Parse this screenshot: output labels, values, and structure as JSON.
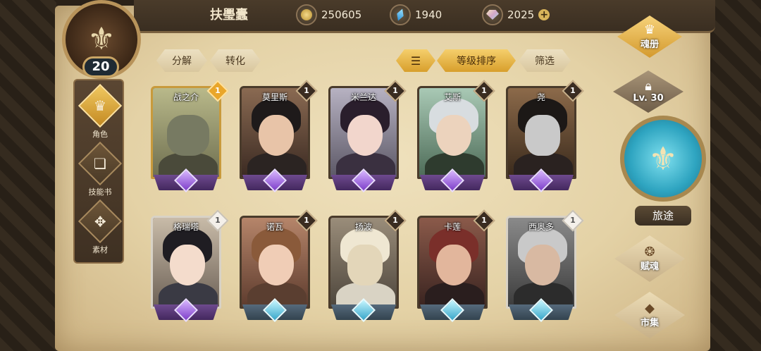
{
  "header": {
    "title": "扶璺蠹",
    "level": "20",
    "currencies": [
      {
        "icon": "gold-coin-icon",
        "value": "250605"
      },
      {
        "icon": "blue-crystal-icon",
        "value": "1940"
      },
      {
        "icon": "gem-icon",
        "value": "2025"
      }
    ]
  },
  "side_nav": [
    {
      "label": "角色",
      "icon": "character-icon",
      "active": true
    },
    {
      "label": "技能书",
      "icon": "skill-book-icon",
      "active": false
    },
    {
      "label": "素材",
      "icon": "material-icon",
      "active": false
    }
  ],
  "toolbar": {
    "decompose": "分解",
    "convert": "转化",
    "sort_icon": "sort-icon",
    "sort_by_level": "等级排序",
    "filter": "筛选"
  },
  "heroes": [
    {
      "name": "战之介",
      "count": "1",
      "badge": "gold",
      "base": "purple"
    },
    {
      "name": "莫里斯",
      "count": "1",
      "badge": "dark",
      "base": "purple"
    },
    {
      "name": "米兰达",
      "count": "1",
      "badge": "dark",
      "base": "purple"
    },
    {
      "name": "艾斯",
      "count": "1",
      "badge": "dark",
      "base": "purple"
    },
    {
      "name": "尧",
      "count": "1",
      "badge": "dark",
      "base": "purple"
    },
    {
      "name": "格瑞塔",
      "count": "1",
      "badge": "silver",
      "base": "purple"
    },
    {
      "name": "诺瓦",
      "count": "1",
      "badge": "dark",
      "base": "blue"
    },
    {
      "name": "扬波",
      "count": "1",
      "badge": "dark",
      "base": "blue"
    },
    {
      "name": "卡莲",
      "count": "1",
      "badge": "dark",
      "base": "blue"
    },
    {
      "name": "西奥多",
      "count": "1",
      "badge": "silver",
      "base": "blue"
    }
  ],
  "right_menu": {
    "soul_book": "魂册",
    "locked_level": "Lv. 30",
    "journey": "旅途",
    "endow_soul": "赋魂",
    "market": "市集"
  }
}
